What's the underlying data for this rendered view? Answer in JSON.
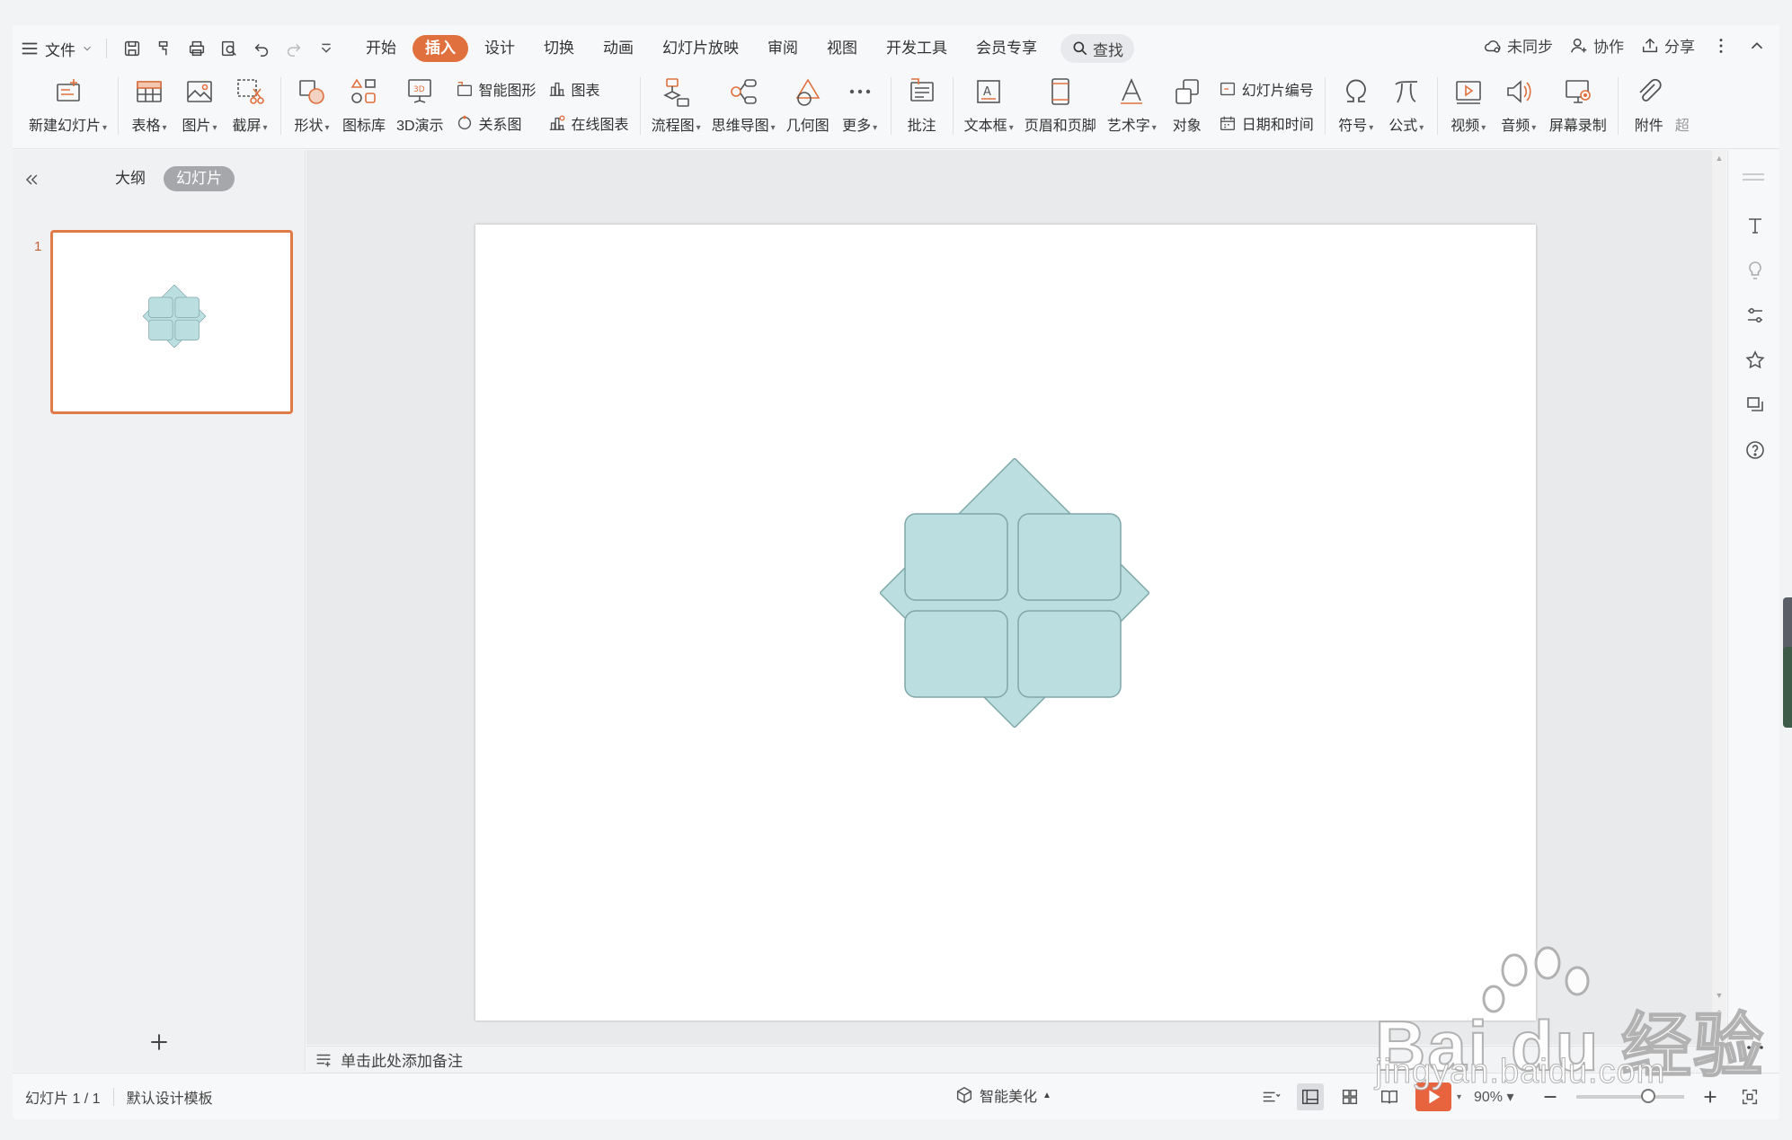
{
  "menu": {
    "file_label": "文件",
    "tabs": [
      {
        "label": "开始",
        "active": false
      },
      {
        "label": "插入",
        "active": true
      },
      {
        "label": "设计",
        "active": false
      },
      {
        "label": "切换",
        "active": false
      },
      {
        "label": "动画",
        "active": false
      },
      {
        "label": "幻灯片放映",
        "active": false
      },
      {
        "label": "审阅",
        "active": false
      },
      {
        "label": "视图",
        "active": false
      },
      {
        "label": "开发工具",
        "active": false
      },
      {
        "label": "会员专享",
        "active": false
      }
    ],
    "search_label": "查找",
    "sync_label": "未同步",
    "collab_label": "协作",
    "share_label": "分享"
  },
  "ribbon": {
    "new_slide": "新建幻灯片",
    "table": "表格",
    "picture": "图片",
    "screenshot": "截屏",
    "shape": "形状",
    "icon_lib": "图标库",
    "demo3d": "3D演示",
    "smart_art": "智能图形",
    "relation": "关系图",
    "chart": "图表",
    "online_chart": "在线图表",
    "flowchart": "流程图",
    "mindmap": "思维导图",
    "geometry": "几何图",
    "more": "更多",
    "comment": "批注",
    "textbox": "文本框",
    "header_footer": "页眉和页脚",
    "wordart": "艺术字",
    "object": "对象",
    "slide_number": "幻灯片编号",
    "datetime": "日期和时间",
    "symbol": "符号",
    "formula": "公式",
    "video": "视频",
    "audio": "音频",
    "screen_record": "屏幕录制",
    "attachment": "附件",
    "overflow": "超"
  },
  "left_panel": {
    "outline_tab": "大纲",
    "slides_tab": "幻灯片",
    "slide_number": "1"
  },
  "notes_placeholder": "单击此处添加备注",
  "status": {
    "slide_info": "幻灯片 1 / 1",
    "template": "默认设计模板",
    "beautify": "智能美化",
    "zoom": "90%"
  },
  "shape_colors": {
    "fill": "#bbdfe1",
    "stroke": "#7fa6a9"
  },
  "accent_color": "#e0703e",
  "watermark": {
    "line1": "Bai du 经验",
    "line2": "jingyan.baidu.com"
  }
}
